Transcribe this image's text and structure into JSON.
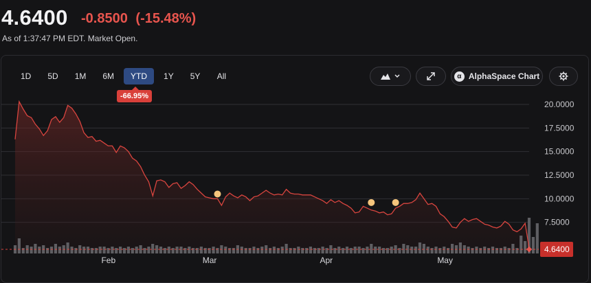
{
  "quote": {
    "price": "4.6400",
    "change": "-0.8500",
    "change_pct": "(-15.48%)",
    "time_text": "As of 1:37:47 PM EDT. Market Open."
  },
  "range_tabs": [
    {
      "label": "1D",
      "active": false
    },
    {
      "label": "5D",
      "active": false
    },
    {
      "label": "1M",
      "active": false
    },
    {
      "label": "6M",
      "active": false
    },
    {
      "label": "YTD",
      "active": true
    },
    {
      "label": "1Y",
      "active": false
    },
    {
      "label": "5Y",
      "active": false
    },
    {
      "label": "All",
      "active": false
    }
  ],
  "ytd_badge": "-66.95%",
  "controls": {
    "chart_type_icon": "mountain-chart-icon",
    "expand_icon": "expand-icon",
    "brand_label": "AlphaSpace Chart",
    "brand_icon": "alphaspace-logo-icon",
    "settings_icon": "gear-icon"
  },
  "colors": {
    "down": "#e8554e",
    "line": "#d9453f",
    "accent_tab": "#2e4a82",
    "event_dot": "#f5c57c",
    "volume": "#6b6b70"
  },
  "chart_data": {
    "type": "area",
    "x_labels": [
      "Feb",
      "Mar",
      "Apr",
      "May"
    ],
    "y_ticks": [
      "20.0000",
      "17.5000",
      "15.0000",
      "12.5000",
      "10.0000",
      "7.5000"
    ],
    "y_tick_values": [
      20,
      17.5,
      15,
      12.5,
      10,
      7.5
    ],
    "ylim": [
      4.2,
      20.8
    ],
    "last_price_label": "4.6400",
    "last_price": 4.64,
    "grid": true,
    "series": [
      {
        "values": [
          16.3,
          20.3,
          19.5,
          18.8,
          18.6,
          17.9,
          17.4,
          16.7,
          17.2,
          18.4,
          18.7,
          18.1,
          18.6,
          19.9,
          19.6,
          19.0,
          18.2,
          17.0,
          16.5,
          16.6,
          16.1,
          16.2,
          15.9,
          15.6,
          15.6,
          14.9,
          15.6,
          15.4,
          15.0,
          14.3,
          14.0,
          13.4,
          12.5,
          11.8,
          10.3,
          11.9,
          12.0,
          11.8,
          11.2,
          11.6,
          11.7,
          11.1,
          11.4,
          11.8,
          11.5,
          11.0,
          10.6,
          10.2,
          10.1,
          10.0,
          10.0,
          9.3,
          10.2,
          10.6,
          10.3,
          10.1,
          10.4,
          10.2,
          9.8,
          10.2,
          10.3,
          10.6,
          10.9,
          10.6,
          10.4,
          10.5,
          10.4,
          11.0,
          10.6,
          10.5,
          10.5,
          10.4,
          10.4,
          10.4,
          10.2,
          10.0,
          9.8,
          9.5,
          9.9,
          9.6,
          9.8,
          9.5,
          9.3,
          9.0,
          8.5,
          8.6,
          9.2,
          9.0,
          8.8,
          8.7,
          8.5,
          8.6,
          8.3,
          8.4,
          9.0,
          9.2,
          9.5,
          9.5,
          9.6,
          9.9,
          10.6,
          10.0,
          9.4,
          9.5,
          9.2,
          8.4,
          8.1,
          7.6,
          7.0,
          6.9,
          7.5,
          7.9,
          7.6,
          7.8,
          7.9,
          7.6,
          7.3,
          7.2,
          7.0,
          6.9,
          7.1,
          7.6,
          7.3,
          6.7,
          6.5,
          6.8,
          7.4,
          4.8
        ]
      }
    ],
    "volume_values": [
      6,
      11,
      4,
      6,
      5,
      7,
      5,
      6,
      4,
      5,
      7,
      5,
      6,
      8,
      5,
      4,
      6,
      5,
      5,
      4,
      4,
      5,
      5,
      4,
      5,
      4,
      5,
      4,
      5,
      4,
      5,
      6,
      4,
      5,
      7,
      6,
      5,
      4,
      5,
      4,
      5,
      5,
      4,
      5,
      4,
      4,
      5,
      4,
      4,
      5,
      4,
      6,
      5,
      4,
      4,
      6,
      5,
      4,
      4,
      5,
      4,
      5,
      6,
      4,
      5,
      4,
      5,
      7,
      4,
      4,
      5,
      4,
      4,
      5,
      4,
      4,
      5,
      4,
      6,
      4,
      5,
      4,
      5,
      4,
      5,
      5,
      4,
      5,
      7,
      5,
      5,
      4,
      4,
      5,
      6,
      4,
      7,
      6,
      5,
      5,
      8,
      7,
      5,
      4,
      5,
      4,
      5,
      4,
      7,
      6,
      8,
      6,
      5,
      4,
      5,
      4,
      5,
      4,
      5,
      4,
      4,
      5,
      4,
      7,
      4,
      13,
      9,
      26,
      12,
      22
    ],
    "event_markers": [
      {
        "index": 50,
        "value": 10.5
      },
      {
        "index": 88,
        "value": 9.6
      },
      {
        "index": 94,
        "value": 9.6
      }
    ]
  }
}
